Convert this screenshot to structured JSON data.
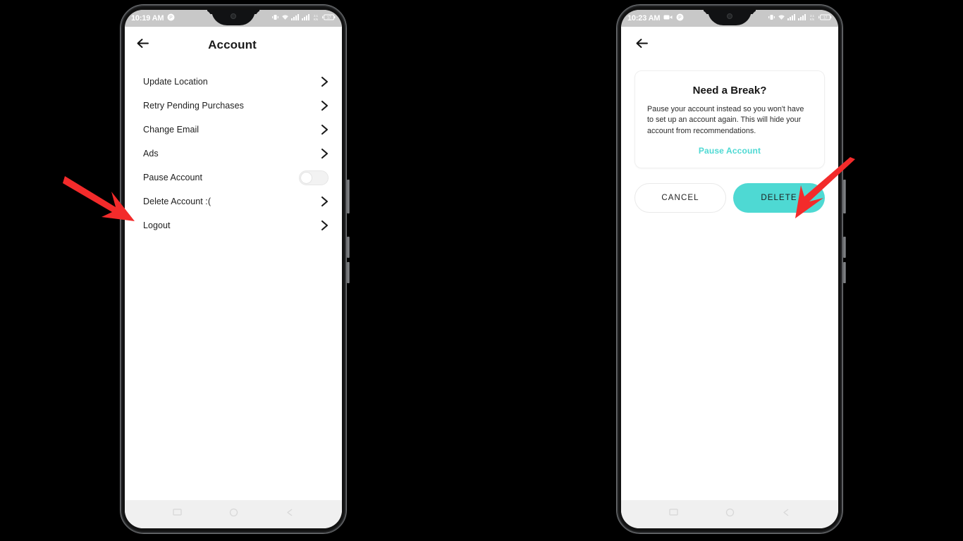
{
  "accent_color": "#4ed9d3",
  "arrow_color": "#f32b2b",
  "phone_left": {
    "status_bar": {
      "time": "10:19 AM",
      "left_icons": [
        "app-badge-icon"
      ],
      "right_icons": [
        "vibrate-icon",
        "wifi-icon",
        "signal-bars-icon",
        "signal-bars-2-icon",
        "network-speed-icon",
        "battery-icon"
      ]
    },
    "app_bar": {
      "back_icon": "back-arrow-icon",
      "title": "Account"
    },
    "settings": [
      {
        "label": "Update Location",
        "control": "chevron"
      },
      {
        "label": "Retry Pending Purchases",
        "control": "chevron"
      },
      {
        "label": "Change Email",
        "control": "chevron"
      },
      {
        "label": "Ads",
        "control": "chevron"
      },
      {
        "label": "Pause Account",
        "control": "toggle",
        "toggle_on": false
      },
      {
        "label": "Delete Account :(",
        "control": "chevron"
      },
      {
        "label": "Logout",
        "control": "chevron"
      }
    ],
    "nav_bar": [
      "recents-icon",
      "home-icon",
      "back-icon"
    ]
  },
  "phone_right": {
    "status_bar": {
      "time": "10:23 AM",
      "left_icons": [
        "video-camera-icon",
        "app-badge-icon"
      ],
      "right_icons": [
        "vibrate-icon",
        "wifi-icon",
        "signal-bars-icon",
        "signal-bars-2-icon",
        "network-speed-icon",
        "battery-icon"
      ]
    },
    "app_bar": {
      "back_icon": "back-arrow-icon"
    },
    "dialog": {
      "title": "Need a Break?",
      "body": "Pause your account instead so you won't have to set up an account again. This will hide your account from recommendations.",
      "action_label": "Pause Account"
    },
    "buttons": {
      "cancel": "CANCEL",
      "delete": "DELETE"
    },
    "nav_bar": [
      "recents-icon",
      "home-icon",
      "back-icon"
    ]
  },
  "annotations": [
    {
      "name": "arrow-to-delete-account",
      "direction": "down-right"
    },
    {
      "name": "arrow-to-delete-button",
      "direction": "down-left"
    }
  ]
}
